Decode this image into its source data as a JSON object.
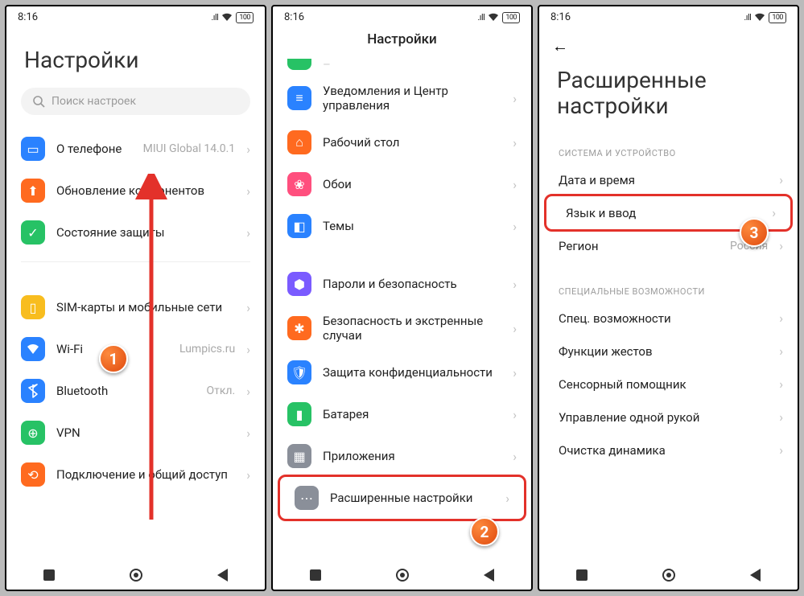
{
  "status": {
    "time": "8:16",
    "signal": ".ıll",
    "wifi": "⋮",
    "battery": "100"
  },
  "screen1": {
    "title": "Настройки",
    "search_placeholder": "Поиск настроек",
    "items": [
      {
        "label": "О телефоне",
        "value": "MIUI Global 14.0.1"
      },
      {
        "label": "Обновление компонентов",
        "value": ""
      },
      {
        "label": "Состояние защиты",
        "value": ""
      },
      {
        "label": "SIM-карты и мобильные сети",
        "value": ""
      },
      {
        "label": "Wi-Fi",
        "value": "Lumpics.ru"
      },
      {
        "label": "Bluetooth",
        "value": "Откл."
      },
      {
        "label": "VPN",
        "value": ""
      },
      {
        "label": "Подключение и общий доступ",
        "value": ""
      }
    ],
    "step": "1"
  },
  "screen2": {
    "title": "Настройки",
    "items": [
      {
        "label": "Уведомления и Центр управления"
      },
      {
        "label": "Рабочий стол"
      },
      {
        "label": "Обои"
      },
      {
        "label": "Темы"
      },
      {
        "label": "Пароли и безопасность"
      },
      {
        "label": "Безопасность и экстренные случаи"
      },
      {
        "label": "Защита конфиденциальности"
      },
      {
        "label": "Батарея"
      },
      {
        "label": "Приложения"
      },
      {
        "label": "Расширенные настройки"
      }
    ],
    "step": "2"
  },
  "screen3": {
    "title": "Расширенные настройки",
    "section1": "СИСТЕМА И УСТРОЙСТВО",
    "section2": "СПЕЦИАЛЬНЫЕ ВОЗМОЖНОСТИ",
    "items1": [
      {
        "label": "Дата и время",
        "value": ""
      },
      {
        "label": "Язык и ввод",
        "value": ""
      },
      {
        "label": "Регион",
        "value": "Россия"
      }
    ],
    "items2": [
      {
        "label": "Спец. возможности"
      },
      {
        "label": "Функции жестов"
      },
      {
        "label": "Сенсорный помощник"
      },
      {
        "label": "Управление одной рукой"
      },
      {
        "label": "Очистка динамика"
      }
    ],
    "step": "3"
  }
}
